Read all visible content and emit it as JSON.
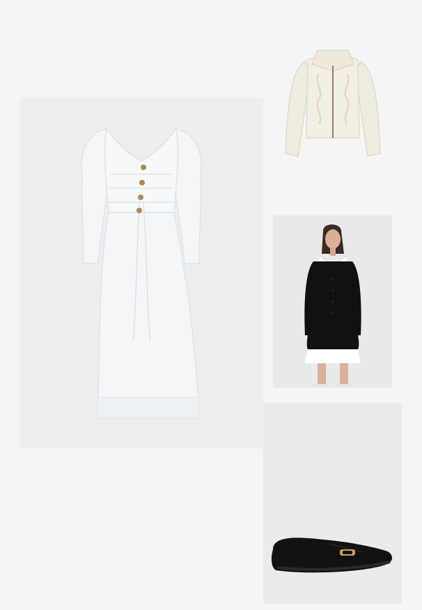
{
  "board": {
    "background": "#f5f5f5"
  },
  "items": [
    {
      "id": "dress",
      "icon": "white-puff-sleeve-midi-dress-image",
      "color": "#f4f6f8"
    },
    {
      "id": "cardigan",
      "icon": "cream-cable-knit-zip-cardigan-image",
      "color": "#f1ece0"
    },
    {
      "id": "jacket",
      "icon": "black-tweed-jacket-look-image",
      "color": "#111111"
    },
    {
      "id": "loafer",
      "icon": "black-leather-loafer-image",
      "color": "#121212"
    }
  ]
}
